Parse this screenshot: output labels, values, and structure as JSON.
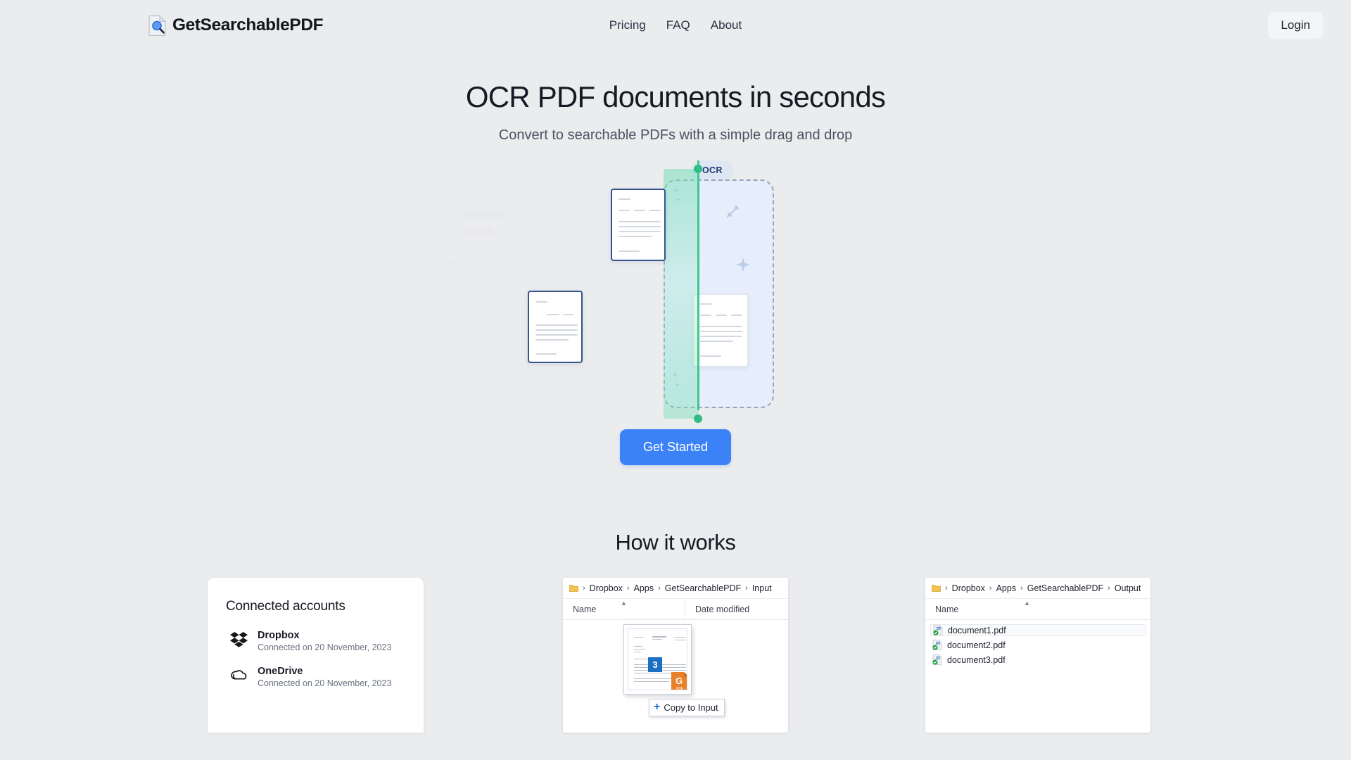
{
  "header": {
    "brand_name": "GetSearchablePDF",
    "brand_icon": "document-search-icon",
    "nav": [
      {
        "label": "Pricing"
      },
      {
        "label": "FAQ"
      },
      {
        "label": "About"
      }
    ],
    "login_label": "Login"
  },
  "hero": {
    "title": "OCR PDF documents in seconds",
    "subtitle": "Convert to searchable PDFs with a simple drag and drop",
    "badge": "OCR",
    "cta_label": "Get Started"
  },
  "how_it_works": {
    "title": "How it works"
  },
  "accounts_card": {
    "title": "Connected accounts",
    "items": [
      {
        "name": "Dropbox",
        "status": "Connected on 20 November, 2023",
        "icon": "dropbox-icon"
      },
      {
        "name": "OneDrive",
        "status": "Connected on 20 November, 2023",
        "icon": "onedrive-icon"
      }
    ]
  },
  "input_explorer": {
    "breadcrumb": [
      "Dropbox",
      "Apps",
      "GetSearchablePDF",
      "Input"
    ],
    "separator": "›",
    "columns": [
      "Name",
      "Date modified"
    ],
    "files": [],
    "drag": {
      "count_badge": "3",
      "copy_tooltip": "Copy to Input",
      "plus": "+"
    }
  },
  "output_explorer": {
    "breadcrumb": [
      "Dropbox",
      "Apps",
      "GetSearchablePDF",
      "Output"
    ],
    "separator": "›",
    "columns": [
      "Name"
    ],
    "files": [
      {
        "name": "document1.pdf",
        "icon": "pdf-checked-icon"
      },
      {
        "name": "document2.pdf",
        "icon": "pdf-checked-icon"
      },
      {
        "name": "document3.pdf",
        "icon": "pdf-checked-icon"
      }
    ]
  },
  "colors": {
    "page_background": "#ebecee",
    "accent_blue": "#3b82f6",
    "scan_green": "#3fc68f",
    "dropzone_blue": "#e7eefb",
    "badge_blue": "#dfe6f3",
    "doc_border": "#35558c",
    "pdf_orange": "#e8822a",
    "badge_navy": "#1c6fc4"
  }
}
